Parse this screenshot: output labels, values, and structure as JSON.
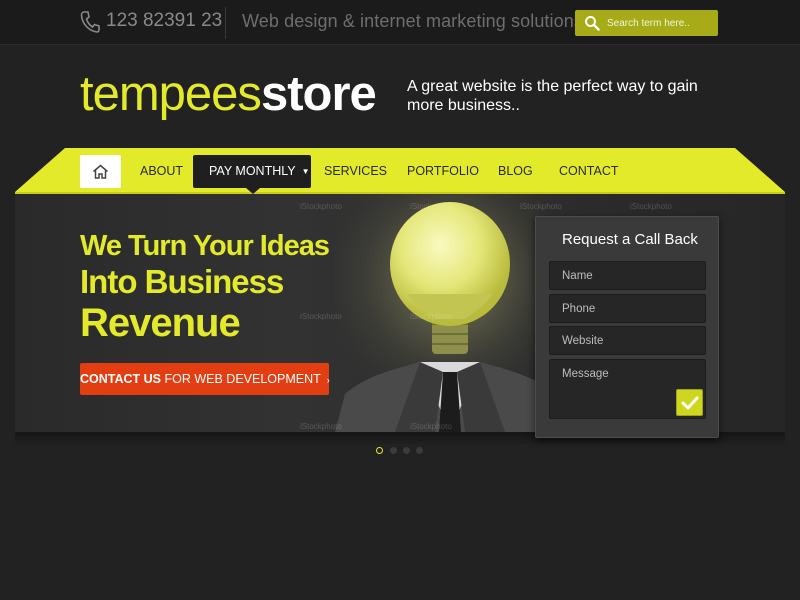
{
  "topbar": {
    "phone": "123 82391 23",
    "tagline": "Web design & internet marketing solutions",
    "search_placeholder": "Search term here.."
  },
  "header": {
    "logo_part1": "tempees",
    "logo_part2": "store",
    "tagline": "A great website is the perfect way to gain more business.."
  },
  "nav": {
    "items": [
      "ABOUT",
      "PAY MONTHLY",
      "SERVICES",
      "PORTFOLIO",
      "BLOG",
      "CONTACT"
    ],
    "active": "PAY MONTHLY",
    "home_icon": "home-icon"
  },
  "hero": {
    "line1": "We Turn Your Ideas",
    "line2": "Into Business",
    "line3": "Revenue",
    "cta_bold": "CONTACT US",
    "cta_rest": "FOR WEB DEVELOPMENT",
    "cta_arrow": "›"
  },
  "callback": {
    "title": "Request a Call Back",
    "fields": [
      "Name",
      "Phone",
      "Website"
    ],
    "message_placeholder": "Message"
  },
  "slider": {
    "count": 4,
    "active_index": 0
  },
  "watermark": "iStockphoto",
  "colors": {
    "accent": "#e3ea2a",
    "search_bg": "#a8ab18",
    "cta": "#e23e12",
    "background": "#222222"
  }
}
